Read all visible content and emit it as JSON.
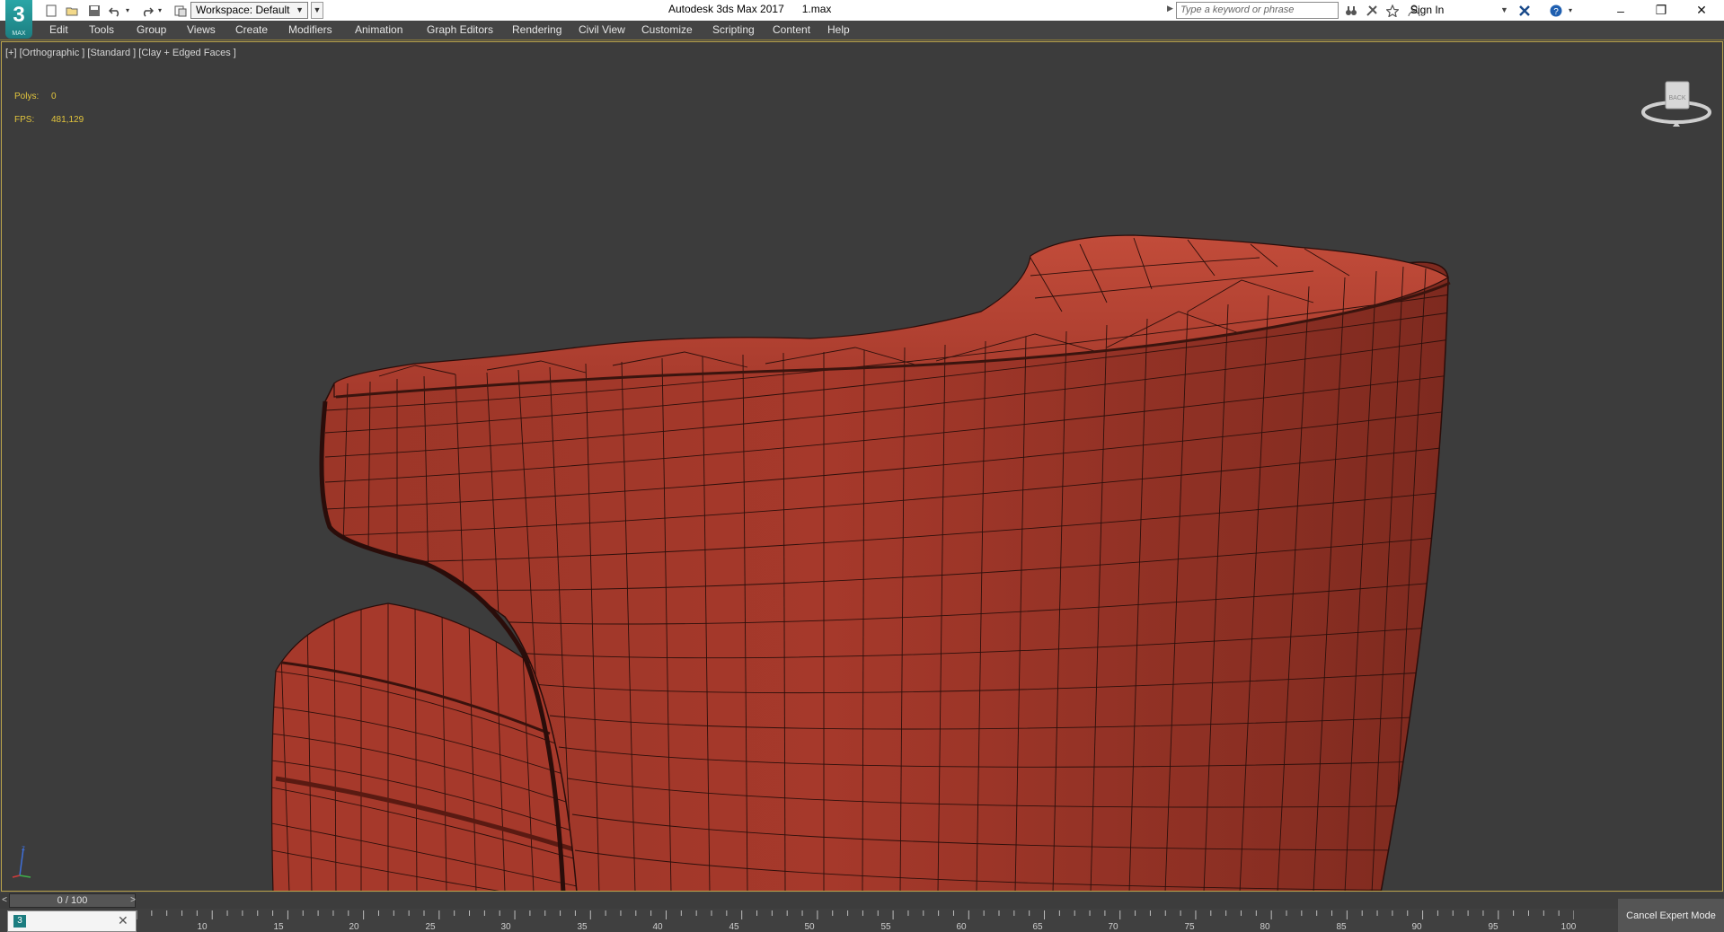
{
  "app": {
    "logo_text": "3",
    "logo_sub": "MAX",
    "title": "Autodesk 3ds Max 2017      1.max",
    "workspace": "Workspace: Default",
    "search_placeholder": "Type a keyword or phrase",
    "sign_in": "Sign In"
  },
  "menu": [
    "Edit",
    "Tools",
    "Group",
    "Views",
    "Create",
    "Modifiers",
    "Animation",
    "Graph Editors",
    "Rendering",
    "Civil View",
    "Customize",
    "Scripting",
    "Content",
    "Help"
  ],
  "viewport": {
    "label": "[+] [Orthographic ] [Standard ] [Clay + Edged Faces ]",
    "polys_label": "Polys:",
    "polys_value": "0",
    "fps_label": "FPS:",
    "fps_value": "481,129",
    "viewcube_face": "BACK",
    "object_color": "#a83a2c",
    "background_color": "#3c3c3c"
  },
  "timeline": {
    "slider_text": "0 / 100",
    "prev": "<",
    "next": ">",
    "ticks": [
      "10",
      "15",
      "20",
      "25",
      "30",
      "35",
      "40",
      "45",
      "50",
      "55",
      "60",
      "65",
      "70",
      "75",
      "80",
      "85",
      "90",
      "95",
      "100"
    ],
    "cancel_expert": "Cancel Expert Mode"
  },
  "icons": {
    "new": "new-file-icon",
    "open": "open-folder-icon",
    "save": "save-icon",
    "undo": "undo-icon",
    "redo": "redo-icon",
    "project": "project-folder-icon",
    "binoculars": "binoculars-icon",
    "satellite": "subscription-icon",
    "star": "favorites-icon",
    "user": "user-icon",
    "exchange": "autodesk-exchange-icon",
    "help": "help-icon"
  }
}
